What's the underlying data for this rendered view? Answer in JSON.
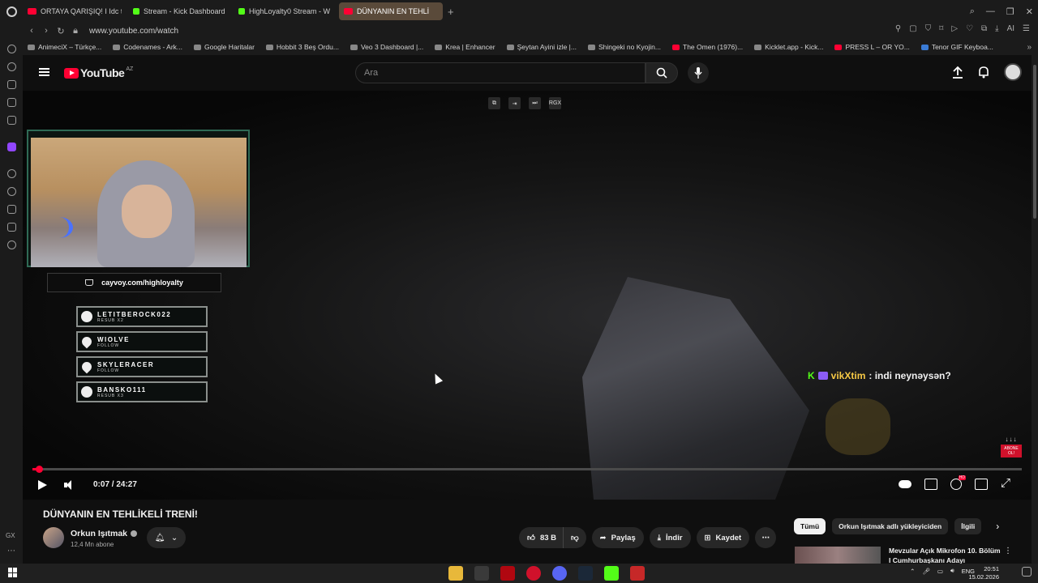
{
  "browser": {
    "tabs": [
      {
        "label": "ORTAYA QARIŞIQ! I Idc ti",
        "icon": "youtube-icon"
      },
      {
        "label": "Stream - Kick Dashboard",
        "icon": "kick-icon"
      },
      {
        "label": "HighLoyalty0 Stream - W",
        "icon": "kick-icon"
      },
      {
        "label": "DÜNYANIN EN TEHLİ",
        "icon": "youtube-icon"
      }
    ],
    "url": "www.youtube.com/watch",
    "bookmarks": [
      "AnimeciX – Türkçe...",
      "Codenames - Ark...",
      "Google Haritalar",
      "Hobbit 3 Beş Ordu...",
      "Veo 3 Dashboard |...",
      "Krea | Enhancer",
      "Şeytan Ayini izle |...",
      "Shingeki no Kyojin...",
      "The Omen (1976)...",
      "Kicklet.app - Kick...",
      "PRESS L – OR YO...",
      "Tenor GIF Keyboa..."
    ],
    "ai_label": "AI",
    "sidebar_gx": "GX"
  },
  "youtube": {
    "logo_text": "YouTube",
    "region": "AZ",
    "search_placeholder": "Ara"
  },
  "player": {
    "top_badge": "RGX",
    "donate_link": "cayvoy.com/highloyalty",
    "alerts": [
      {
        "name": "LETITBEROCK022",
        "type": "RESUB X2",
        "icon": "user-icon"
      },
      {
        "name": "WIOLVE",
        "type": "FOLLOW",
        "icon": "heart-icon"
      },
      {
        "name": "SKYLERACER",
        "type": "FOLLOW",
        "icon": "heart-icon"
      },
      {
        "name": "BANSKO111",
        "type": "RESUB X3",
        "icon": "user-icon"
      }
    ],
    "chat": {
      "user": "vikXtim",
      "message": ": indi neynəysən?"
    },
    "abone": {
      "arrows": "↓↓↓",
      "label": "ABONE OL!"
    },
    "time": "0:07 / 24:27",
    "progress_fraction": 0.0048,
    "hd_badge": "HD"
  },
  "video": {
    "title": "DÜNYANIN EN TEHLİKELİ TRENİ!",
    "channel": "Orkun Işıtmak",
    "subscribers": "12,4 Mn abone",
    "likes": "83 B",
    "share": "Paylaş",
    "download": "İndir",
    "save": "Kaydet"
  },
  "related": {
    "chips": [
      "Tümü",
      "Orkun Işıtmak adlı yükleyiciden",
      "İlgili"
    ],
    "first_title": "Mevzular Açık Mikrofon 10. Bölüm I Cumhurbaşkanı Adayı"
  },
  "taskbar": {
    "lang": "ENG",
    "time": "20:51",
    "date": "15.02.2026"
  },
  "colors": {
    "youtube_red": "#ff0033",
    "kick_green": "#53fc18",
    "chat_user": "#f6c945",
    "abone_red": "#d0112b"
  }
}
